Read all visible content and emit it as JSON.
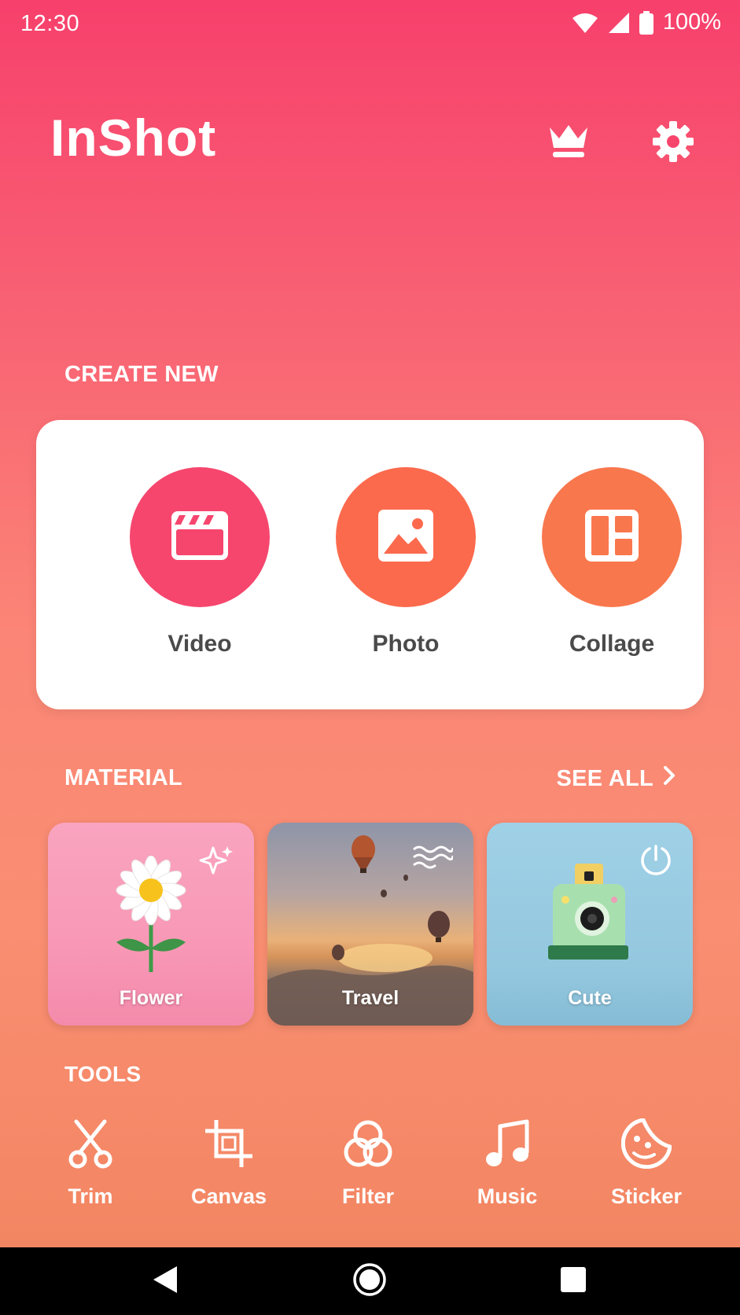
{
  "status_bar": {
    "time": "12:30",
    "battery": "100%"
  },
  "header": {
    "logo_text": "InShot"
  },
  "create": {
    "title": "CREATE NEW",
    "items": [
      {
        "label": "Video",
        "icon": "clapperboard-icon",
        "color": "#f6466e"
      },
      {
        "label": "Photo",
        "icon": "image-icon",
        "color": "#fc6a4e"
      },
      {
        "label": "Collage",
        "icon": "collage-icon",
        "color": "#f9774d"
      }
    ]
  },
  "material": {
    "title": "MATERIAL",
    "see_all": "SEE ALL",
    "items": [
      {
        "label": "Flower",
        "badge_icon": "sparkle-icon"
      },
      {
        "label": "Travel",
        "badge_icon": "wave-icon"
      },
      {
        "label": "Cute",
        "badge_icon": "timer-icon"
      }
    ]
  },
  "tools": {
    "title": "TOOLS",
    "items": [
      {
        "label": "Trim",
        "icon": "scissors-icon"
      },
      {
        "label": "Canvas",
        "icon": "crop-icon"
      },
      {
        "label": "Filter",
        "icon": "filter-icon"
      },
      {
        "label": "Music",
        "icon": "music-note-icon"
      },
      {
        "label": "Sticker",
        "icon": "sticker-icon"
      }
    ]
  },
  "colors": {
    "accent": "#f6466e",
    "nav_bg": "#000000"
  }
}
